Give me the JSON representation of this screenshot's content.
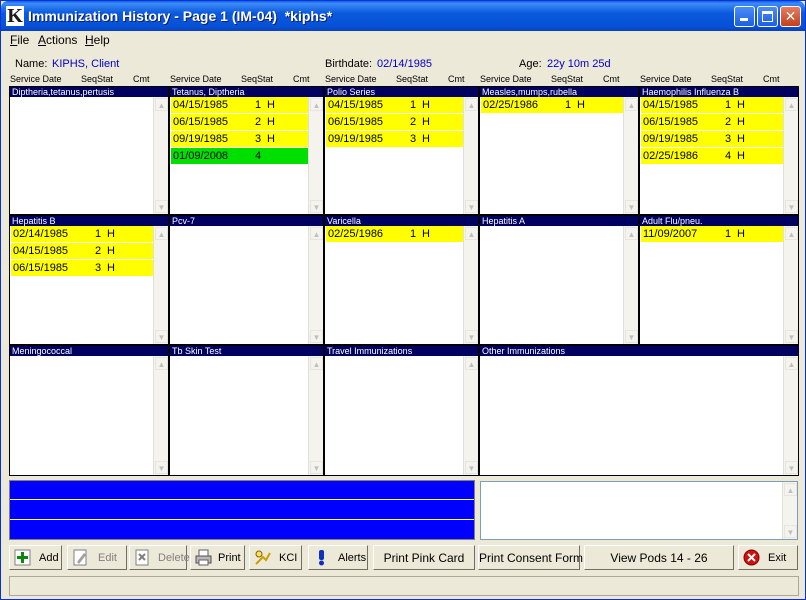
{
  "window": {
    "title": "Immunization History - Page 1 (IM-04)  *kiphs*",
    "logo_letter": "K"
  },
  "menu": [
    {
      "label": "File",
      "ul": "F",
      "rest": "ile"
    },
    {
      "label": "Actions",
      "ul": "A",
      "rest": "ctions"
    },
    {
      "label": "Help",
      "ul": "H",
      "rest": "elp"
    }
  ],
  "client": {
    "name_label": "Name:",
    "name": "KIPHS, Client",
    "birthdate_label": "Birthdate:",
    "birthdate": "02/14/1985",
    "age_label": "Age:",
    "age": "22y 10m 25d"
  },
  "columns": [
    "Service Date",
    "Seq",
    "Stat",
    "Cmt"
  ],
  "pods": [
    {
      "title": "Diptheria,tetanus,pertusis",
      "rows": []
    },
    {
      "title": "Tetanus, Diptheria",
      "rows": [
        {
          "date": "04/15/1985",
          "seq": "1",
          "stat": "H",
          "color": "yellow"
        },
        {
          "date": "06/15/1985",
          "seq": "2",
          "stat": "H",
          "color": "yellow"
        },
        {
          "date": "09/19/1985",
          "seq": "3",
          "stat": "H",
          "color": "yellow"
        },
        {
          "date": "01/09/2008",
          "seq": "4",
          "stat": "",
          "color": "green"
        }
      ]
    },
    {
      "title": "Polio Series",
      "rows": [
        {
          "date": "04/15/1985",
          "seq": "1",
          "stat": "H",
          "color": "yellow"
        },
        {
          "date": "06/15/1985",
          "seq": "2",
          "stat": "H",
          "color": "yellow"
        },
        {
          "date": "09/19/1985",
          "seq": "3",
          "stat": "H",
          "color": "yellow"
        }
      ]
    },
    {
      "title": "Measles,mumps,rubella",
      "rows": [
        {
          "date": "02/25/1986",
          "seq": "1",
          "stat": "H",
          "color": "yellow"
        }
      ]
    },
    {
      "title": "Haemophilis Influenza B",
      "rows": [
        {
          "date": "04/15/1985",
          "seq": "1",
          "stat": "H",
          "color": "yellow"
        },
        {
          "date": "06/15/1985",
          "seq": "2",
          "stat": "H",
          "color": "yellow"
        },
        {
          "date": "09/19/1985",
          "seq": "3",
          "stat": "H",
          "color": "yellow"
        },
        {
          "date": "02/25/1986",
          "seq": "4",
          "stat": "H",
          "color": "yellow"
        }
      ]
    },
    {
      "title": "Hepatitis B",
      "rows": [
        {
          "date": "02/14/1985",
          "seq": "1",
          "stat": "H",
          "color": "yellow"
        },
        {
          "date": "04/15/1985",
          "seq": "2",
          "stat": "H",
          "color": "yellow"
        },
        {
          "date": "06/15/1985",
          "seq": "3",
          "stat": "H",
          "color": "yellow"
        }
      ]
    },
    {
      "title": "Pcv-7",
      "rows": []
    },
    {
      "title": "Varicella",
      "rows": [
        {
          "date": "02/25/1986",
          "seq": "1",
          "stat": "H",
          "color": "yellow"
        }
      ]
    },
    {
      "title": "Hepatitis A",
      "rows": []
    },
    {
      "title": "Adult Flu/pneu.",
      "rows": [
        {
          "date": "11/09/2007",
          "seq": "1",
          "stat": "H",
          "color": "yellow"
        }
      ]
    },
    {
      "title": "Meningococcal",
      "rows": []
    },
    {
      "title": "Tb Skin Test",
      "rows": []
    },
    {
      "title": "Travel Immunizations",
      "rows": []
    },
    {
      "title": "Other Immunizations",
      "rows": []
    }
  ],
  "row_colors": {
    "yellow": "#ffff00",
    "green": "#00e000"
  },
  "toolbar": {
    "add": "Add",
    "edit": "Edit",
    "delete": "Delete",
    "print": "Print",
    "kci": "KCI",
    "alerts": "Alerts",
    "print_pink_card": "Print Pink Card",
    "print_consent_form": "Print Consent Form",
    "view_pods": "View Pods 14 - 26",
    "exit": "Exit"
  },
  "icons": {
    "add": "plus-icon",
    "edit": "pencil-icon",
    "delete": "delete-icon",
    "print": "printer-icon",
    "kci": "kci-icon",
    "alerts": "alert-icon",
    "exit": "exit-icon"
  }
}
